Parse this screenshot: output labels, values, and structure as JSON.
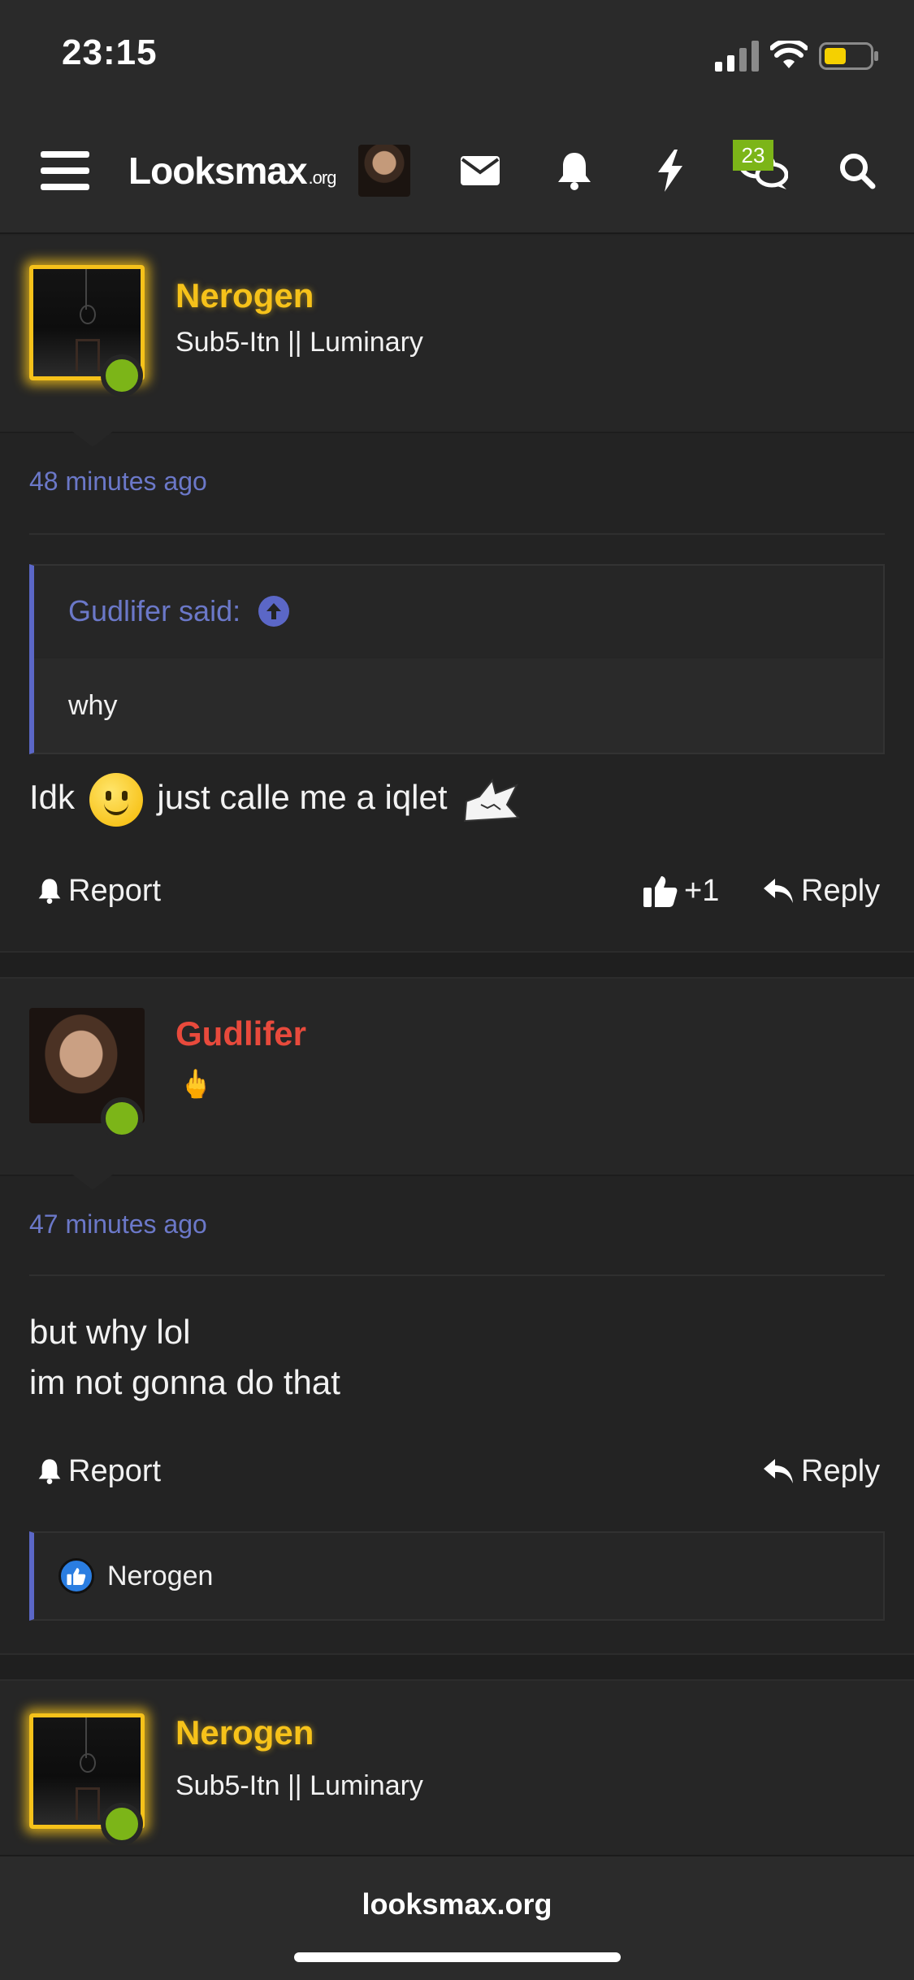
{
  "status": {
    "time": "23:15"
  },
  "nav": {
    "logo_main": "Looksmax",
    "logo_suffix": ".org",
    "conversations_badge": "23"
  },
  "posts": [
    {
      "username": "Nerogen",
      "user_title": "Sub5-Itn || Luminary",
      "timestamp": "48 minutes ago",
      "quote": {
        "author": "Gudlifer said:",
        "text": "why"
      },
      "message_parts": [
        "Idk",
        "just calle me a iqlet"
      ],
      "actions": {
        "report": "Report",
        "like_count": "+1",
        "reply": "Reply"
      }
    },
    {
      "username": "Gudlifer",
      "user_title": "🖕",
      "timestamp": "47 minutes ago",
      "message_lines": [
        "but why lol",
        "im not gonna do that"
      ],
      "actions": {
        "report": "Report",
        "reply": "Reply"
      },
      "reactions": {
        "users": "Nerogen"
      }
    },
    {
      "username": "Nerogen",
      "user_title": "Sub5-Itn || Luminary"
    }
  ],
  "bottom": {
    "url": "looksmax.org"
  },
  "colors": {
    "background": "#242424",
    "gold_username": "#f6c21a",
    "red_username": "#e84a3c",
    "link_blue": "#6b78c8",
    "online_green": "#7cb518"
  }
}
